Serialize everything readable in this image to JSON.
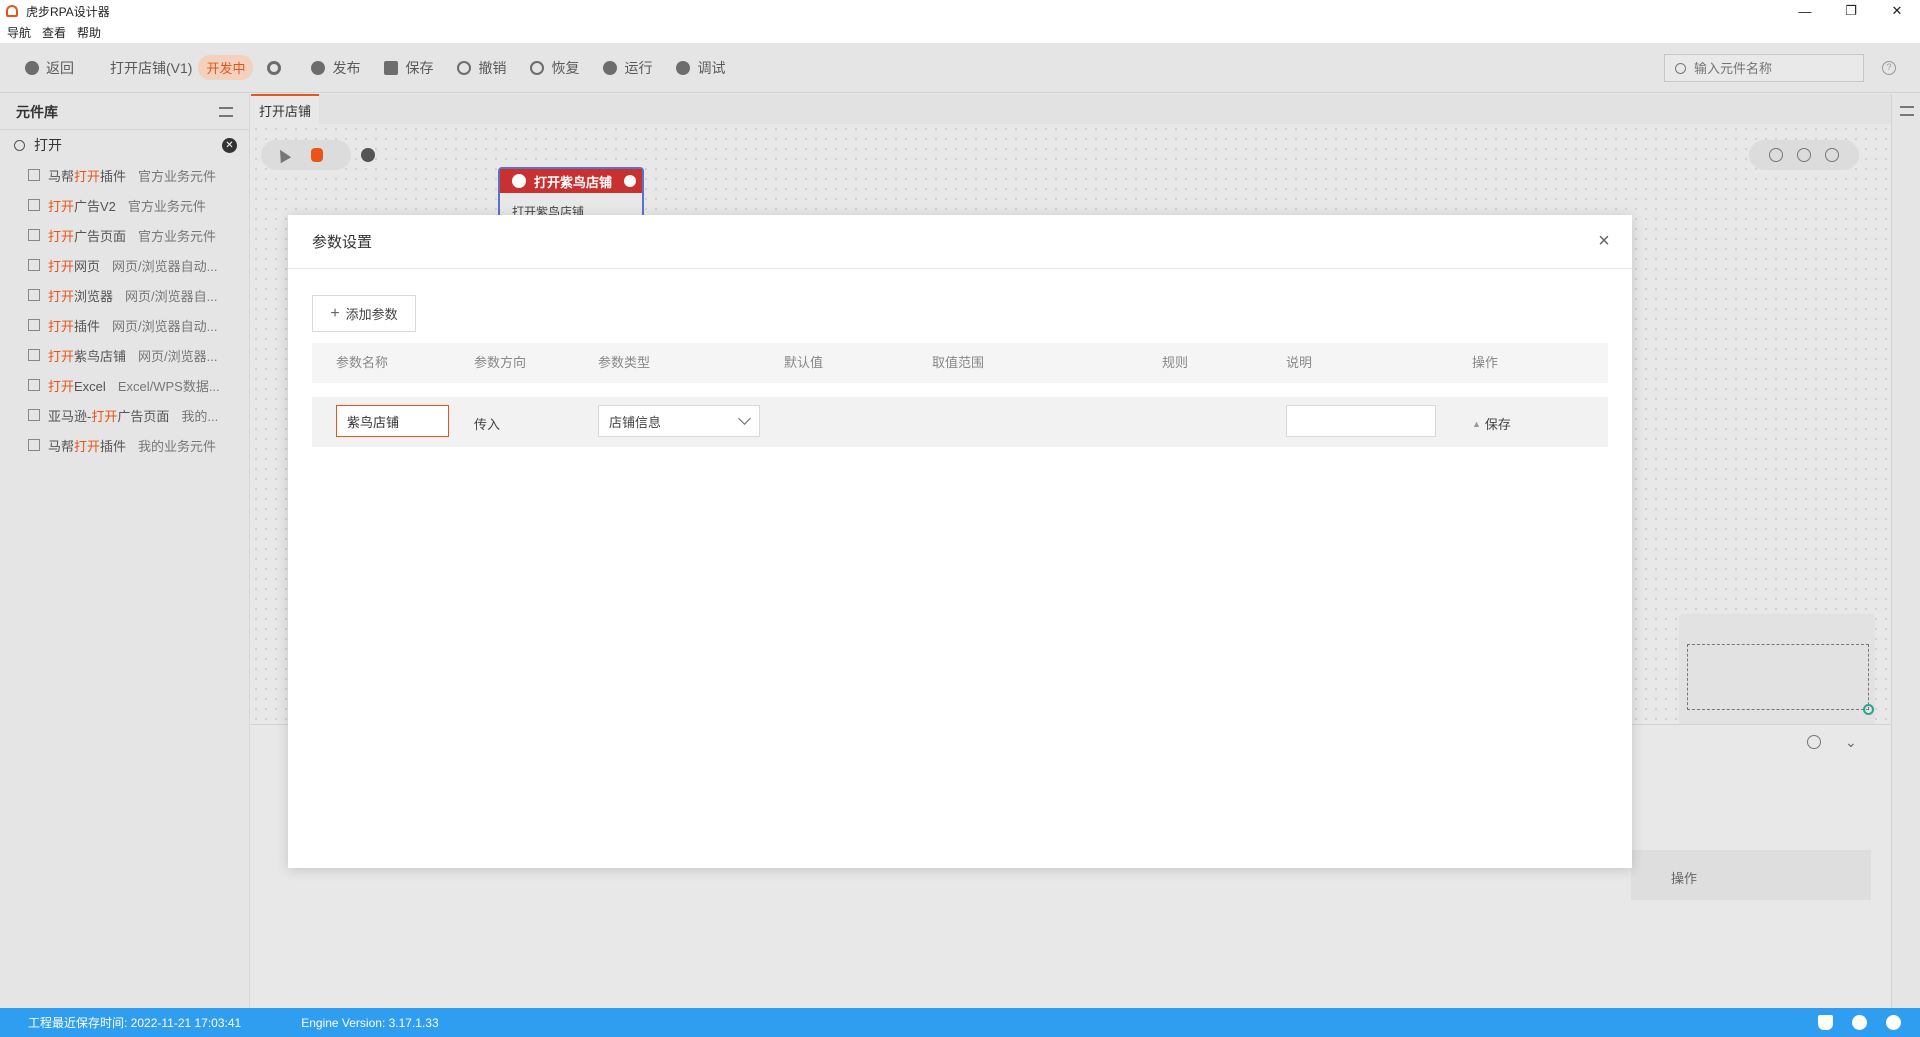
{
  "window": {
    "title": "虎步RPA设计器",
    "controls": [
      "—",
      "❐",
      "✕"
    ]
  },
  "menu": [
    "导航",
    "查看",
    "帮助"
  ],
  "toolbar": {
    "back_label": "返回",
    "project_name": "打开店铺(V1)",
    "status": "开发中",
    "publish_label": "发布",
    "save_label": "保存",
    "undo_label": "撤销",
    "redo_label": "恢复",
    "run_label": "运行",
    "debug_label": "调试",
    "search_placeholder": "输入元件名称"
  },
  "library": {
    "title": "元件库",
    "search_value": "打开",
    "items": [
      {
        "pre": "马帮",
        "hl": "打开",
        "post": "插件",
        "category": "官方业务元件"
      },
      {
        "pre": "",
        "hl": "打开",
        "post": "广告V2",
        "category": "官方业务元件"
      },
      {
        "pre": "",
        "hl": "打开",
        "post": "广告页面",
        "category": "官方业务元件"
      },
      {
        "pre": "",
        "hl": "打开",
        "post": "网页",
        "category": "网页/浏览器自动..."
      },
      {
        "pre": "",
        "hl": "打开",
        "post": "浏览器",
        "category": "网页/浏览器自..."
      },
      {
        "pre": "",
        "hl": "打开",
        "post": "插件",
        "category": "网页/浏览器自动..."
      },
      {
        "pre": "",
        "hl": "打开",
        "post": "紫鸟店铺",
        "category": "网页/浏览器..."
      },
      {
        "pre": "",
        "hl": "打开",
        "post": "Excel",
        "category": "Excel/WPS数据..."
      },
      {
        "pre": "亚马逊-",
        "hl": "打开",
        "post": "广告页面",
        "category": "我的..."
      },
      {
        "pre": "马帮",
        "hl": "打开",
        "post": "插件",
        "category": "我的业务元件"
      }
    ]
  },
  "canvas": {
    "tab_label": "打开店铺",
    "node_title": "打开紫鸟店铺",
    "node_body": "打开紫鸟店铺"
  },
  "bottom_panel": {
    "op_header": "操作"
  },
  "modal": {
    "title": "参数设置",
    "add_button": "添加参数",
    "headers": [
      "参数名称",
      "参数方向",
      "参数类型",
      "默认值",
      "取值范围",
      "规则",
      "说明",
      "操作"
    ],
    "row": {
      "name": "紫鸟店铺",
      "direction": "传入",
      "type": "店铺信息",
      "description": "",
      "action": "保存"
    }
  },
  "statusbar": {
    "save_time": "工程最近保存时间: 2022-11-21 17:03:41",
    "engine_version": "Engine Version: 3.17.1.33"
  },
  "colors": {
    "accent": "#e8551a",
    "status_bar": "#2f9ef0",
    "node_header": "#c8312f",
    "node_border": "#5b72c9"
  }
}
